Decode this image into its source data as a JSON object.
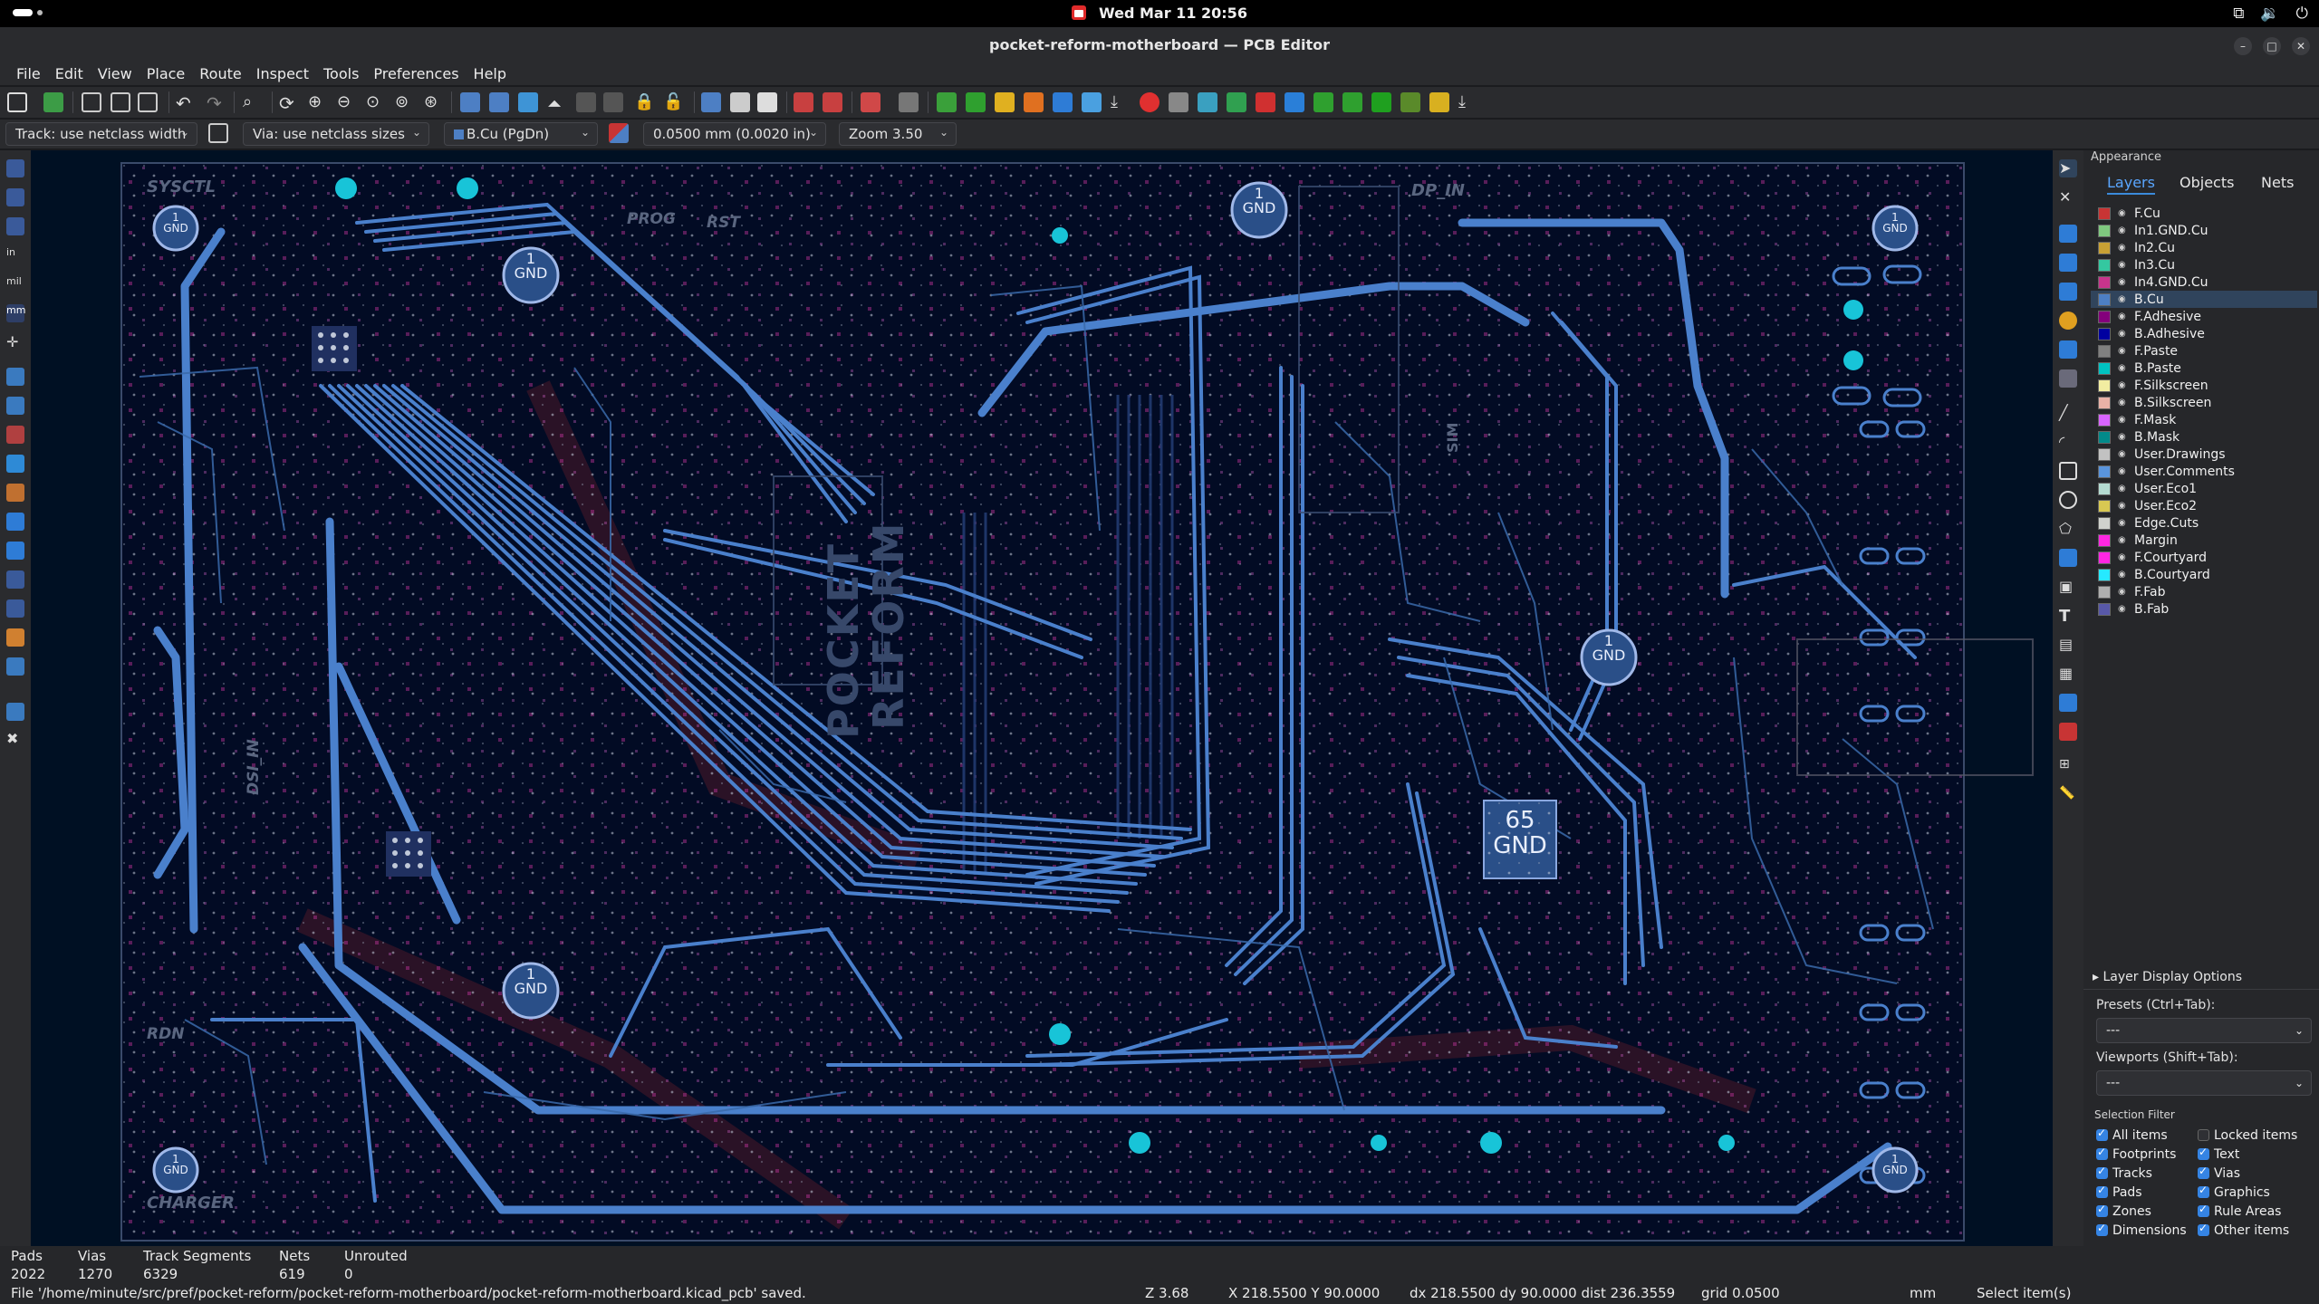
{
  "system": {
    "clock": "Wed Mar 11  20:56"
  },
  "window": {
    "title": "pocket-reform-motherboard — PCB Editor"
  },
  "menu": [
    "File",
    "Edit",
    "View",
    "Place",
    "Route",
    "Inspect",
    "Tools",
    "Preferences",
    "Help"
  ],
  "options": {
    "track": "Track: use netclass width",
    "via": "Via: use netclass sizes",
    "layer": "B.Cu (PgDn)",
    "grid": "0.0500 mm (0.0020 in)",
    "zoom": "Zoom 3.50"
  },
  "board": {
    "silkscreen": [
      "SYSCTL",
      "PROG",
      "RST",
      "DP_IN",
      "DSI_IN",
      "RDN",
      "CHARGER",
      "SIM",
      "POCKET",
      "REFORM"
    ],
    "gnd_label": "GND",
    "gnd_number": "1",
    "big_gnd_number": "65"
  },
  "appearance": {
    "title": "Appearance",
    "tabs": [
      "Layers",
      "Objects",
      "Nets"
    ],
    "layers": [
      {
        "name": "F.Cu",
        "color": "#c83434"
      },
      {
        "name": "In1.GND.Cu",
        "color": "#7fc87f"
      },
      {
        "name": "In2.Cu",
        "color": "#c8a034"
      },
      {
        "name": "In3.Cu",
        "color": "#34c8a0"
      },
      {
        "name": "In4.GND.Cu",
        "color": "#c8348c"
      },
      {
        "name": "B.Cu",
        "color": "#4d7fc4"
      },
      {
        "name": "F.Adhesive",
        "color": "#84007c"
      },
      {
        "name": "B.Adhesive",
        "color": "#0000a0"
      },
      {
        "name": "F.Paste",
        "color": "#808080"
      },
      {
        "name": "B.Paste",
        "color": "#00c2c2"
      },
      {
        "name": "F.Silkscreen",
        "color": "#f2eda1"
      },
      {
        "name": "B.Silkscreen",
        "color": "#e8b2a7"
      },
      {
        "name": "F.Mask",
        "color": "#d864ff"
      },
      {
        "name": "B.Mask",
        "color": "#028a8a"
      },
      {
        "name": "User.Drawings",
        "color": "#c2c2c2"
      },
      {
        "name": "User.Comments",
        "color": "#5994dc"
      },
      {
        "name": "User.Eco1",
        "color": "#b4dbd2"
      },
      {
        "name": "User.Eco2",
        "color": "#d8c852"
      },
      {
        "name": "Edge.Cuts",
        "color": "#d0d2cd"
      },
      {
        "name": "Margin",
        "color": "#ff26e2"
      },
      {
        "name": "F.Courtyard",
        "color": "#ff26e2"
      },
      {
        "name": "B.Courtyard",
        "color": "#26e9ff"
      },
      {
        "name": "F.Fab",
        "color": "#afafaf"
      },
      {
        "name": "B.Fab",
        "color": "#5858a8"
      }
    ],
    "layer_display_options": "Layer Display Options",
    "presets_label": "Presets (Ctrl+Tab):",
    "presets_value": "---",
    "viewports_label": "Viewports (Shift+Tab):",
    "viewports_value": "---",
    "selection_filter": "Selection Filter",
    "filters": [
      {
        "label": "All items",
        "checked": true
      },
      {
        "label": "Locked items",
        "checked": false
      },
      {
        "label": "Footprints",
        "checked": true
      },
      {
        "label": "Text",
        "checked": true
      },
      {
        "label": "Tracks",
        "checked": true
      },
      {
        "label": "Vias",
        "checked": true
      },
      {
        "label": "Pads",
        "checked": true
      },
      {
        "label": "Graphics",
        "checked": true
      },
      {
        "label": "Zones",
        "checked": true
      },
      {
        "label": "Rule Areas",
        "checked": true
      },
      {
        "label": "Dimensions",
        "checked": true
      },
      {
        "label": "Other items",
        "checked": true
      }
    ]
  },
  "stats": [
    {
      "label": "Pads",
      "value": "2022"
    },
    {
      "label": "Vias",
      "value": "1270"
    },
    {
      "label": "Track Segments",
      "value": "6329"
    },
    {
      "label": "Nets",
      "value": "619"
    },
    {
      "label": "Unrouted",
      "value": "0"
    }
  ],
  "status": {
    "message": "File '/home/minute/src/pref/pocket-reform/pocket-reform-motherboard/pocket-reform-motherboard.kicad_pcb' saved.",
    "zoom": "Z 3.68",
    "coords": "X 218.5500  Y 90.0000",
    "delta": "dx 218.5500  dy 90.0000  dist 236.3559",
    "grid": "grid 0.0500",
    "units": "mm",
    "mode": "Select item(s)"
  }
}
